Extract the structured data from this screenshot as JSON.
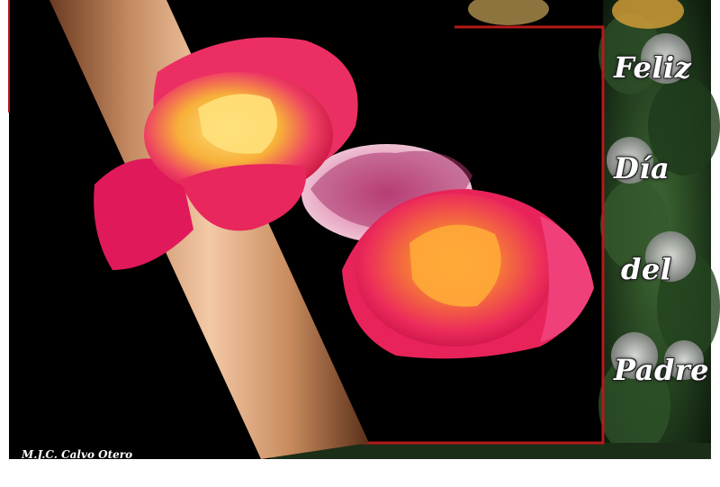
{
  "card": {
    "greeting_words": [
      "Feliz",
      "Día",
      "del",
      "Padre"
    ],
    "signature": "M.J.C. Calvo Otero"
  },
  "colors": {
    "background": "#000000",
    "border": "#ffffff",
    "frame_accent": "#b51a1a",
    "column": "#d9a07a",
    "rose_pink": "#e8245a",
    "rose_yellow": "#f6d24a",
    "foliage": "#1f3a1e"
  }
}
